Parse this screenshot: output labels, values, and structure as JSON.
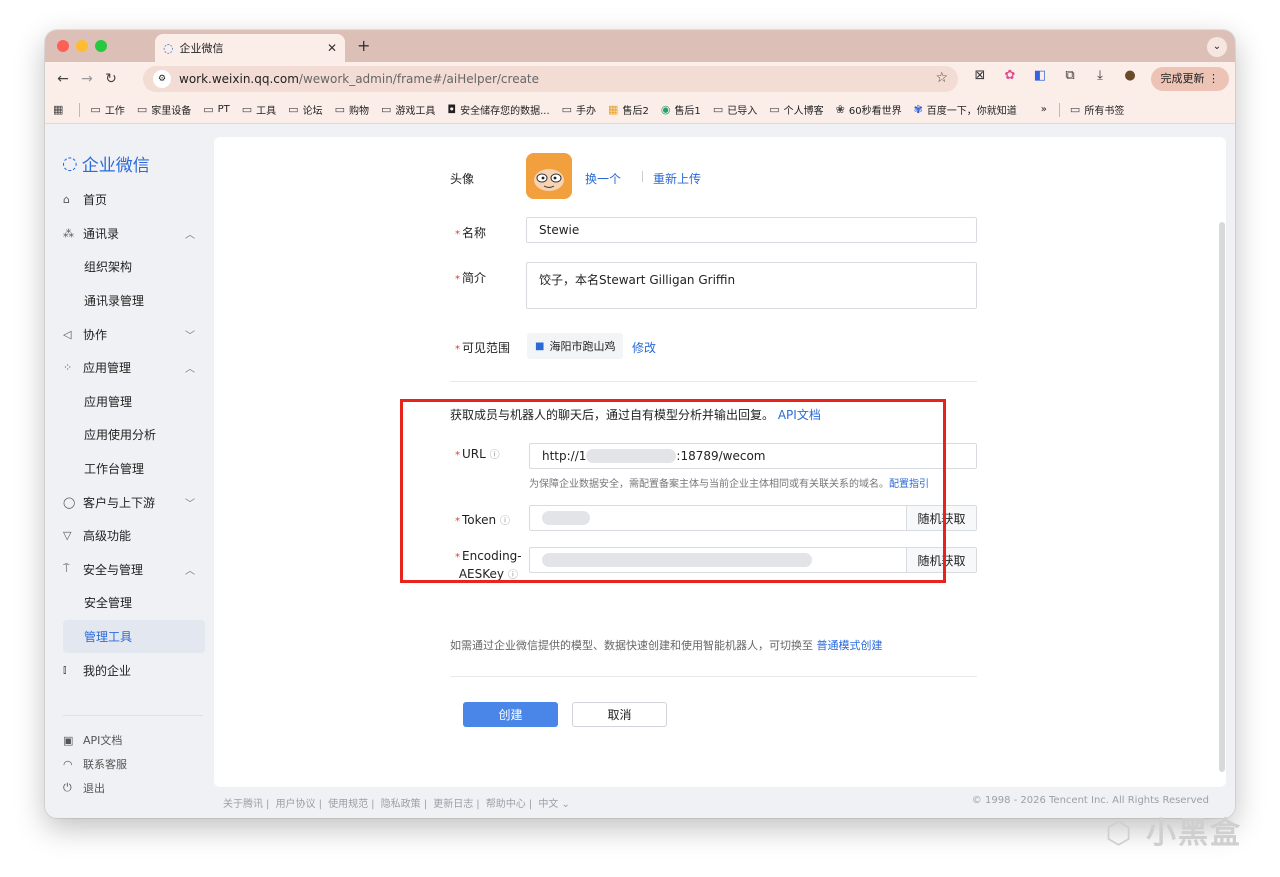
{
  "browser": {
    "tab_title": "企业微信",
    "url_host": "work.weixin.qq.com",
    "url_path": "/wework_admin/frame#/aiHelper/create",
    "update_label": "完成更新",
    "bookmarks": [
      "工作",
      "家里设备",
      "PT",
      "工具",
      "论坛",
      "购物",
      "游戏工具",
      "安全储存您的数据...",
      "手办",
      "售后2",
      "售后1",
      "已导入",
      "个人博客",
      "60秒看世界",
      "百度一下，你就知道"
    ],
    "all_bookmarks": "所有书签",
    "more": "»"
  },
  "sidebar": {
    "logo": "企业微信",
    "items": [
      {
        "label": "首页"
      },
      {
        "label": "通讯录"
      },
      {
        "label": "组织架构"
      },
      {
        "label": "通讯录管理"
      },
      {
        "label": "协作"
      },
      {
        "label": "应用管理"
      },
      {
        "label": "应用管理"
      },
      {
        "label": "应用使用分析"
      },
      {
        "label": "工作台管理"
      },
      {
        "label": "客户与上下游"
      },
      {
        "label": "高级功能"
      },
      {
        "label": "安全与管理"
      },
      {
        "label": "安全管理"
      },
      {
        "label": "管理工具"
      },
      {
        "label": "我的企业"
      }
    ],
    "bottom": [
      {
        "label": "API文档"
      },
      {
        "label": "联系客服"
      },
      {
        "label": "退出"
      }
    ]
  },
  "form": {
    "avatar_label": "头像",
    "avatar_change": "换一个",
    "avatar_reupload": "重新上传",
    "name_label": "名称",
    "name_value": "Stewie",
    "intro_label": "简介",
    "intro_value": "饺子，本名Stewart Gilligan Griffin",
    "scope_label": "可见范围",
    "scope_value": "海阳市跑山鸡",
    "scope_edit": "修改",
    "desc_text": "获取成员与机器人的聊天后，通过自有模型分析并输出回复。",
    "desc_link": "API文档",
    "url_label": "URL",
    "url_prefix": "http://1",
    "url_suffix": ":18789/wecom",
    "url_hint": "为保障企业数据安全，需配置备案主体与当前企业主体相同或有关联关系的域名。",
    "url_hint_link": "配置指引",
    "token_label": "Token",
    "aeskey_label_1": "Encoding-",
    "aeskey_label_2": "AESKey",
    "random_label": "随机获取",
    "switch_text": "如需通过企业微信提供的模型、数据快速创建和使用智能机器人，可切换至",
    "switch_link": "普通模式创建",
    "create_label": "创建",
    "cancel_label": "取消"
  },
  "footer": {
    "links": [
      "关于腾讯",
      "用户协议",
      "使用规范",
      "隐私政策",
      "更新日志",
      "帮助中心",
      "中文 ⌄"
    ],
    "copyright": "© 1998 - 2026 Tencent Inc. All Rights Reserved"
  },
  "watermark": "小黑盒",
  "colors": {
    "accent": "#2a6ad9",
    "primary_button": "#4a86e8",
    "highlight_box": "#e8231b"
  }
}
